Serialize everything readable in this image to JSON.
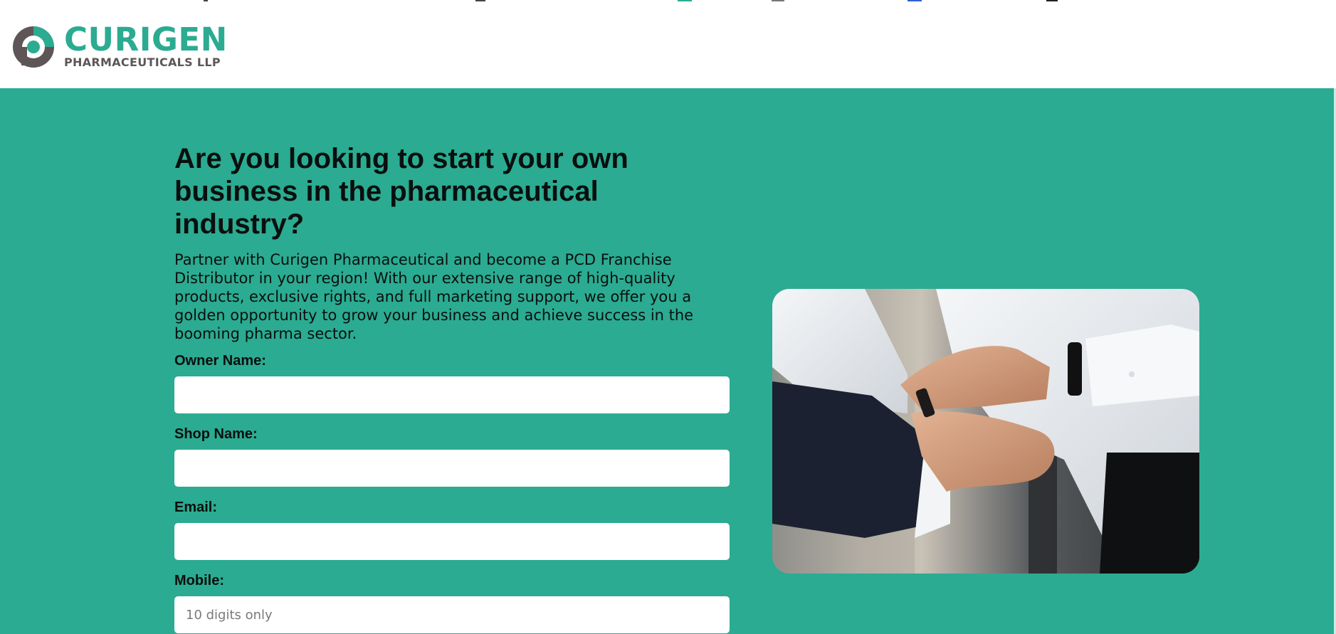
{
  "brand": {
    "name": "CURIGEN",
    "subtitle": "PHARMACEUTICALS LLP",
    "primary_color": "#2bab91",
    "text_color": "#5e5656"
  },
  "hero": {
    "background": "#2bab91",
    "headline": "Are you looking to start your own business in the pharmaceutical industry?",
    "intro": "Partner with Curigen Pharmaceutical and become a PCD Franchise Distributor in your region! With our extensive range of high-quality products, exclusive rights, and full marketing support, we offer you a golden opportunity to grow your business and achieve success in the booming pharma sector."
  },
  "form": {
    "fields": [
      {
        "label": "Owner Name:",
        "value": "",
        "placeholder": ""
      },
      {
        "label": "Shop Name:",
        "value": "",
        "placeholder": ""
      },
      {
        "label": "Email:",
        "value": "",
        "placeholder": ""
      },
      {
        "label": "Mobile:",
        "value": "",
        "placeholder": "10 digits only"
      }
    ]
  },
  "image": {
    "subject": "teamwork-hands-photo"
  }
}
